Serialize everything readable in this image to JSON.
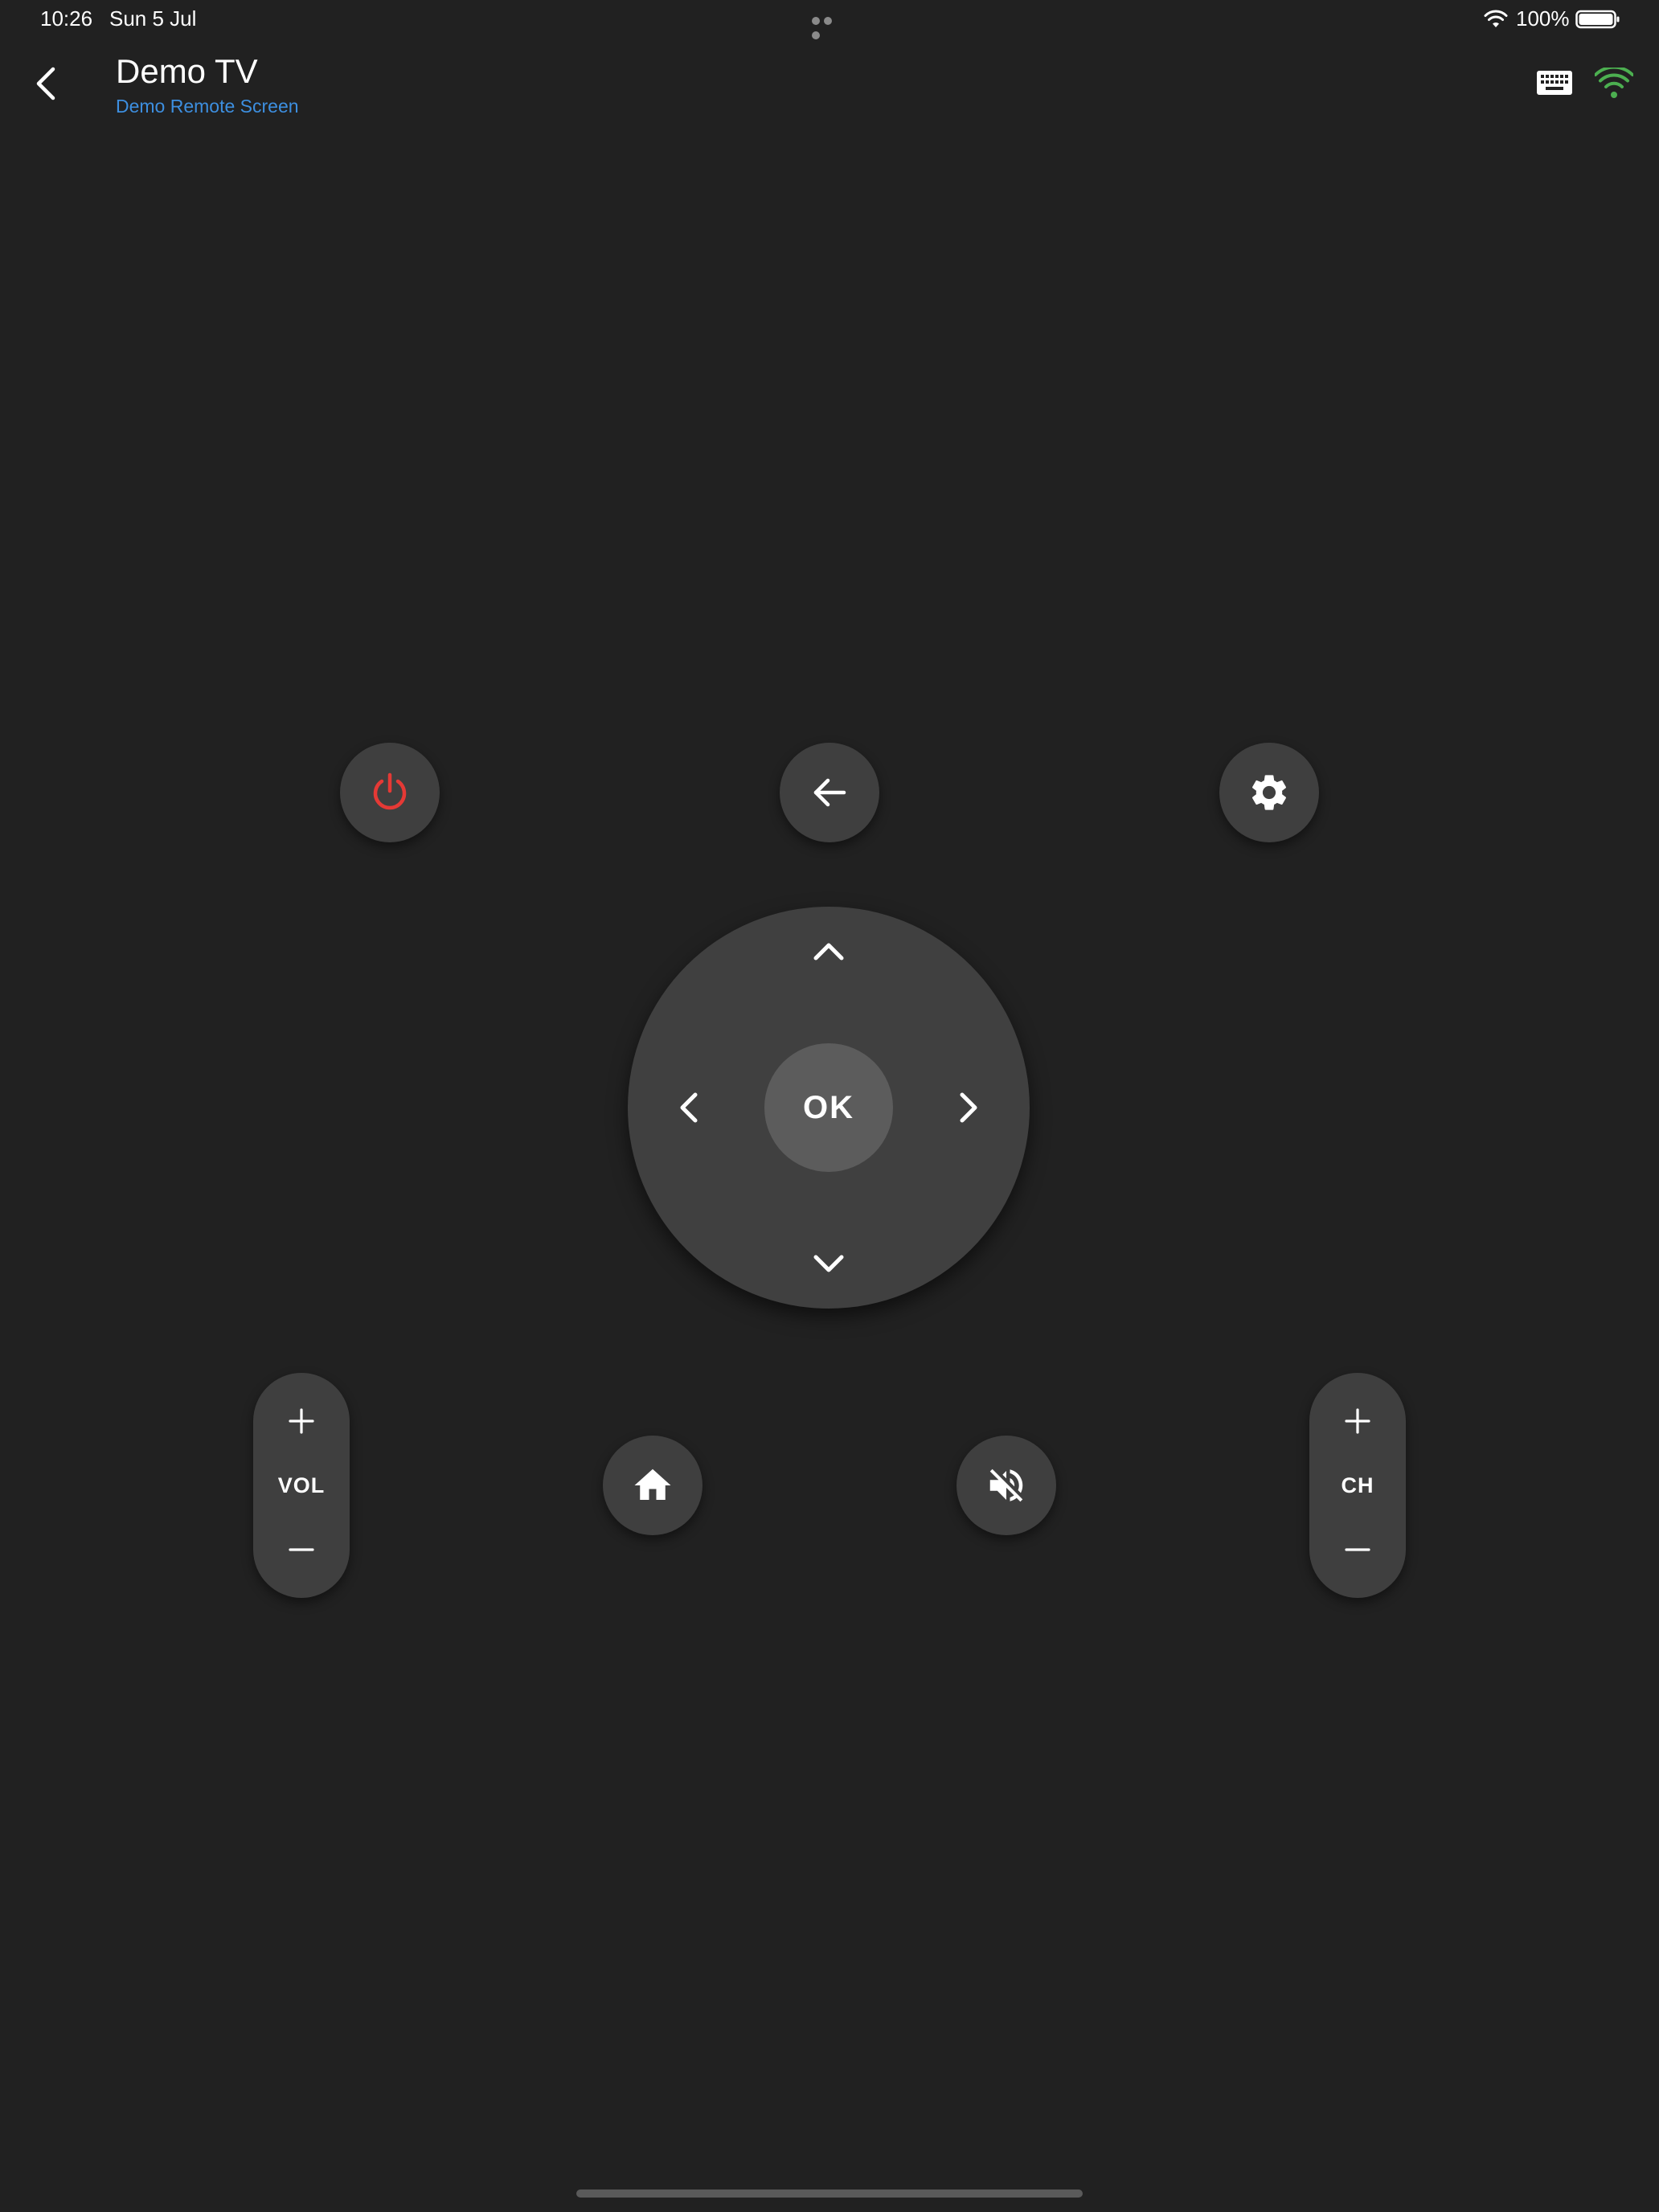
{
  "status_bar": {
    "time": "10:26",
    "date": "Sun 5 Jul",
    "battery": "100%"
  },
  "app_bar": {
    "title": "Demo TV",
    "subtitle": "Demo Remote Screen",
    "icons": {
      "back": "chevron-left-icon",
      "keyboard": "keyboard-icon",
      "connection": "wifi-icon"
    },
    "connection_color": "#4caf50",
    "subtitle_color": "#3d8fe0"
  },
  "remote": {
    "power": {
      "icon": "power-icon",
      "color": "#e53935"
    },
    "back": {
      "icon": "arrow-left-icon"
    },
    "settings": {
      "icon": "gear-icon"
    },
    "dpad": {
      "ok_label": "OK",
      "up_icon": "chevron-up-icon",
      "down_icon": "chevron-down-icon",
      "left_icon": "chevron-left-icon",
      "right_icon": "chevron-right-icon"
    },
    "home": {
      "icon": "home-icon"
    },
    "mute": {
      "icon": "volume-off-icon"
    },
    "volume": {
      "label": "VOL",
      "up_icon": "plus-icon",
      "down_icon": "minus-icon"
    },
    "channel": {
      "label": "CH",
      "up_icon": "plus-icon",
      "down_icon": "minus-icon"
    }
  },
  "colors": {
    "background": "#212121",
    "button": "#3f3f3f",
    "ok_button": "#5c5c5c"
  }
}
